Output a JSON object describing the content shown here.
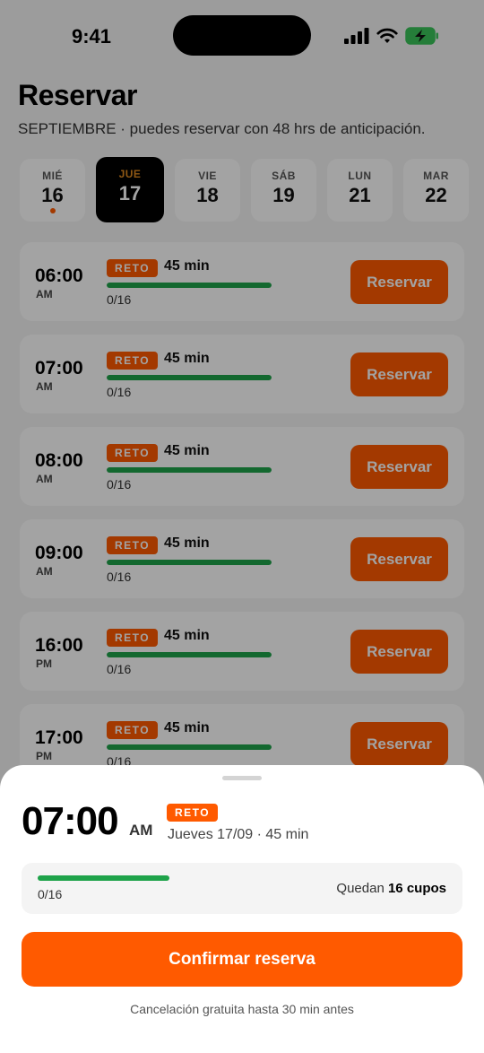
{
  "status": {
    "time": "9:41"
  },
  "header": {
    "title": "Reservar",
    "subtitle": "SEPTIEMBRE · puedes reservar con 48 hrs de anticipación."
  },
  "days": [
    {
      "name": "MIÉ",
      "num": "16"
    },
    {
      "name": "JUE",
      "num": "17"
    },
    {
      "name": "VIE",
      "num": "18"
    },
    {
      "name": "SÁB",
      "num": "19"
    },
    {
      "name": "LUN",
      "num": "21"
    },
    {
      "name": "MAR",
      "num": "22"
    }
  ],
  "slots": [
    {
      "time": "06:00",
      "ampm": "AM",
      "badge": "RETO",
      "duration": "45 min",
      "count": "0/16",
      "button": "Reservar"
    },
    {
      "time": "07:00",
      "ampm": "AM",
      "badge": "RETO",
      "duration": "45 min",
      "count": "0/16",
      "button": "Reservar"
    },
    {
      "time": "08:00",
      "ampm": "AM",
      "badge": "RETO",
      "duration": "45 min",
      "count": "0/16",
      "button": "Reservar"
    },
    {
      "time": "09:00",
      "ampm": "AM",
      "badge": "RETO",
      "duration": "45 min",
      "count": "0/16",
      "button": "Reservar"
    },
    {
      "time": "16:00",
      "ampm": "PM",
      "badge": "RETO",
      "duration": "45 min",
      "count": "0/16",
      "button": "Reservar"
    },
    {
      "time": "17:00",
      "ampm": "PM",
      "badge": "RETO",
      "duration": "45 min",
      "count": "0/16",
      "button": "Reservar"
    }
  ],
  "sheet": {
    "time": "07:00",
    "ampm": "AM",
    "badge": "RETO",
    "info": "Jueves 17/09 · 45 min",
    "count": "0/16",
    "remaining_prefix": "Quedan",
    "remaining_value": "16 cupos",
    "confirm_label": "Confirmar reserva",
    "note": "Cancelación gratuita hasta 30 min antes"
  },
  "colors": {
    "accent": "#ff5a00",
    "progress": "#1ea34a",
    "active_day_label": "#e08a20"
  }
}
